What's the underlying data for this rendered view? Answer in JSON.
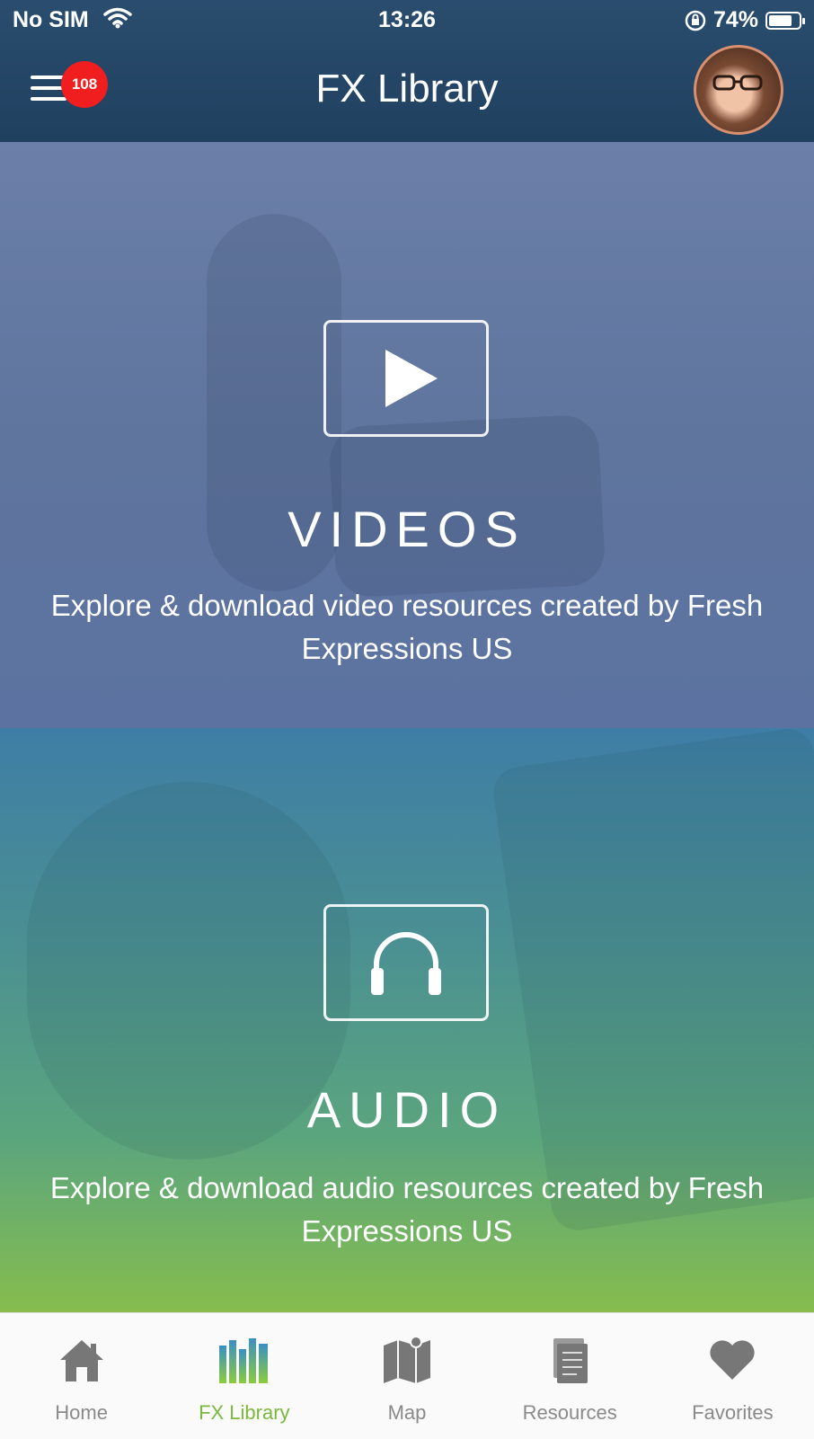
{
  "status_bar": {
    "carrier": "No SIM",
    "time": "13:26",
    "battery": "74%"
  },
  "header": {
    "title": "FX Library",
    "notification_count": "108"
  },
  "panels": [
    {
      "heading": "VIDEOS",
      "description": "Explore & download video resources created by Fresh Expressions US",
      "icon": "play-icon"
    },
    {
      "heading": "AUDIO",
      "description": "Explore & download audio resources created by Fresh Expressions US",
      "icon": "headphones-icon"
    }
  ],
  "tabbar": {
    "items": [
      {
        "label": "Home",
        "icon": "home-icon",
        "active": false
      },
      {
        "label": "FX Library",
        "icon": "library-icon",
        "active": true
      },
      {
        "label": "Map",
        "icon": "map-icon",
        "active": false
      },
      {
        "label": "Resources",
        "icon": "resources-icon",
        "active": false
      },
      {
        "label": "Favorites",
        "icon": "heart-icon",
        "active": false
      }
    ]
  },
  "colors": {
    "header": "#20405f",
    "badge": "#f01e1e",
    "active_tab": "#7ab83e",
    "inactive_tab": "#8a8a8a"
  }
}
